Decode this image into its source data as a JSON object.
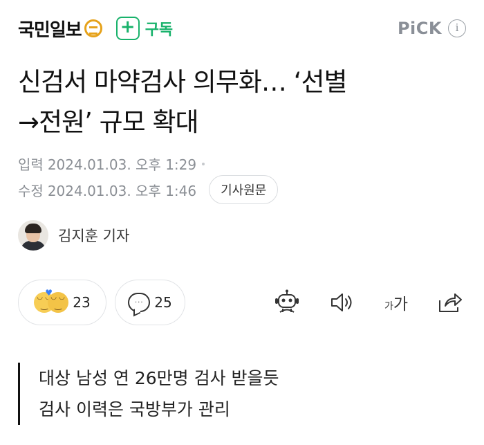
{
  "header": {
    "press_name": "국민일보",
    "subscribe_icon": "plus-icon",
    "subscribe_label": "구독",
    "pick_label": "PiCK",
    "info_glyph": "i"
  },
  "article": {
    "title_line1": "신검서 마약검사 의무화… ‘선별",
    "title_line2": "→전원’ 규모 확대",
    "input_label": "입력",
    "input_time": "2024.01.03. 오후 1:29",
    "modified_label": "수정",
    "modified_time": "2024.01.03. 오후 1:46",
    "original_button": "기사원문",
    "reporter": "김지훈 기자"
  },
  "actions": {
    "reaction_count": "23",
    "comment_count": "25",
    "comment_glyph": "···",
    "font_small": "가",
    "font_large": "가"
  },
  "summary": {
    "line1": "대상 남성 연 26만명 검사 받을듯",
    "line2": "검사 이력은 국방부가 관리"
  },
  "colors": {
    "brand_green": "#18b26b",
    "logo_gold": "#e6a21a",
    "meta_gray": "#8b8f95"
  }
}
